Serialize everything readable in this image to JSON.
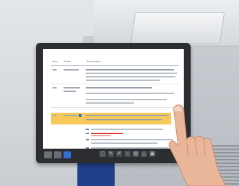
{
  "panel": {
    "header": {
      "col1": "Item",
      "col2": "Action",
      "col3": "Description"
    },
    "toolbar_icons": [
      "select-tool-icon",
      "edit-tool-icon",
      "pen-tool-icon",
      "annotate-tool-icon",
      "print-tool-icon",
      "share-tool-icon",
      "save-tool-icon"
    ]
  }
}
